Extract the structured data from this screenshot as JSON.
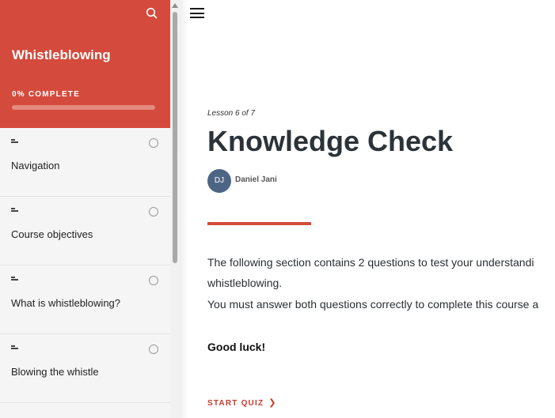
{
  "sidebar": {
    "course_title": "Whistleblowing",
    "progress_label": "0% COMPLETE",
    "progress_fraction": 0,
    "accent_color": "#d44a3c",
    "search_icon": "search-icon",
    "lessons": [
      {
        "label": "Navigation"
      },
      {
        "label": "Course objectives"
      },
      {
        "label": "What is whistleblowing?"
      },
      {
        "label": "Blowing the whistle"
      }
    ]
  },
  "header": {
    "menu_icon": "hamburger-menu-icon"
  },
  "main": {
    "lesson_counter": "Lesson 6 of 7",
    "title": "Knowledge Check",
    "author": {
      "initials": "DJ",
      "name": "Daniel Jani"
    },
    "paragraphs": [
      "The following section contains 2 questions to test your understandi",
      "whistleblowing.",
      "You must answer both questions correctly to complete this course a"
    ],
    "closing": "Good luck!",
    "start_quiz_label": "START QUIZ"
  }
}
